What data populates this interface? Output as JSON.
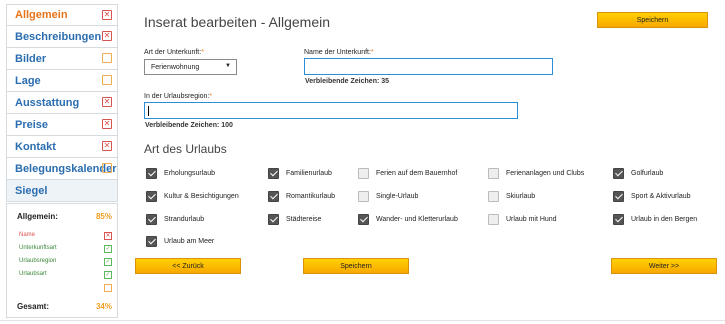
{
  "sidebar": {
    "items": [
      {
        "label": "Allgemein",
        "status": "x",
        "active": true
      },
      {
        "label": "Beschreibungen",
        "status": "x"
      },
      {
        "label": "Bilder",
        "status": "o"
      },
      {
        "label": "Lage",
        "status": "o"
      },
      {
        "label": "Ausstattung",
        "status": "x"
      },
      {
        "label": "Preise",
        "status": "x"
      },
      {
        "label": "Kontakt",
        "status": "x"
      },
      {
        "label": "Belegungskalender",
        "status": "o"
      },
      {
        "label": "Siegel",
        "status": "none"
      }
    ],
    "status_box": {
      "heading": "Allgemein:",
      "heading_pct": "85%",
      "items": [
        {
          "label": "Name",
          "state": "error"
        },
        {
          "label": "Unterkunftsart",
          "state": "ok"
        },
        {
          "label": "Urlaubsregion",
          "state": "ok"
        },
        {
          "label": "Urlaubsart",
          "state": "ok"
        }
      ],
      "total_label": "Gesamt:",
      "total_pct": "34%"
    }
  },
  "main": {
    "title": "Inserat bearbeiten - Allgemein",
    "save_top": "Speichern",
    "unterkunft_label": "Art der Unterkunft:",
    "unterkunft_value": "Ferienwohnung",
    "name_label": "Name der Unterkunft:",
    "name_value": "",
    "name_remaining": "Verbleibende Zeichen: 35",
    "region_label": "In der Urlaubsregion:",
    "region_value": "",
    "region_remaining": "Verbleibende Zeichen: 100",
    "required_mark": "*",
    "section_title": "Art des Urlaubs",
    "vacation_types": [
      {
        "label": "Erholungsurlaub",
        "checked": true
      },
      {
        "label": "Familienurlaub",
        "checked": true
      },
      {
        "label": "Ferien auf dem Bauernhof",
        "checked": false
      },
      {
        "label": "Ferienanlagen und Clubs",
        "checked": false
      },
      {
        "label": "Golfurlaub",
        "checked": true
      },
      {
        "label": "Kultur & Besichtigungen",
        "checked": true
      },
      {
        "label": "Romantikurlaub",
        "checked": true
      },
      {
        "label": "Single-Urlaub",
        "checked": false
      },
      {
        "label": "Skiurlaub",
        "checked": false
      },
      {
        "label": "Sport & Aktivurlaub",
        "checked": true
      },
      {
        "label": "Strandurlaub",
        "checked": true
      },
      {
        "label": "Städtereise",
        "checked": true
      },
      {
        "label": "Wander- und Kletterurlaub",
        "checked": true
      },
      {
        "label": "Urlaub mit Hund",
        "checked": false
      },
      {
        "label": "Urlaub in den Bergen",
        "checked": true
      },
      {
        "label": "Urlaub am Meer",
        "checked": true
      }
    ],
    "back_button": "<< Zurück",
    "save_bottom": "Speichern",
    "next_button": "Weiter >>"
  },
  "colors": {
    "accent": "#e8741a",
    "link": "#2a6db0",
    "button_yellow": "#ffc400",
    "error": "#d9534f",
    "ok": "#5cb85c"
  }
}
